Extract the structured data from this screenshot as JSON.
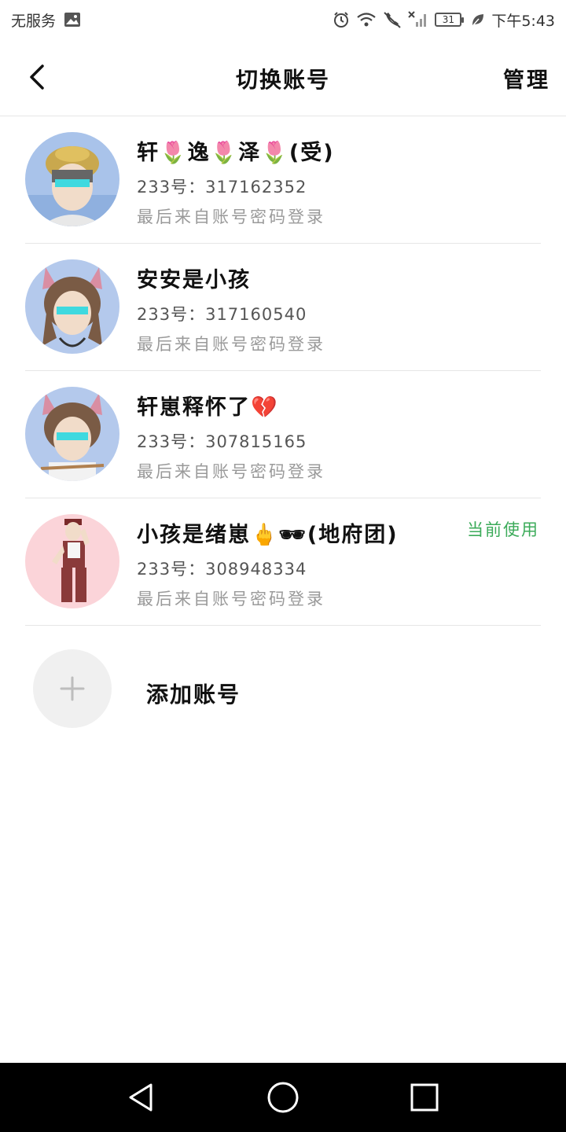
{
  "status_bar": {
    "carrier": "无服务",
    "time": "下午5:43",
    "battery": "31",
    "icons": [
      "image-icon",
      "alarm-icon",
      "wifi-icon",
      "no-call-icon",
      "no-signal-icon",
      "battery-icon",
      "leaf-icon"
    ]
  },
  "header": {
    "title": "切换账号",
    "manage_label": "管理",
    "back_icon": "back-arrow-icon"
  },
  "accounts": [
    {
      "name": "轩🌷逸🌷泽🌷(受)",
      "id_text": "233号：317162352",
      "login_text": "最后来自账号密码登录",
      "current": ""
    },
    {
      "name": "安安是小孩",
      "id_text": "233号：317160540",
      "login_text": "最后来自账号密码登录",
      "current": ""
    },
    {
      "name": "轩崽释怀了💔",
      "id_text": "233号：307815165",
      "login_text": "最后来自账号密码登录",
      "current": ""
    },
    {
      "name": "小孩是绪崽🖕🕶(地府团)",
      "id_text": "233号：308948334",
      "login_text": "最后来自账号密码登录",
      "current": "当前使用"
    }
  ],
  "add_account": {
    "label": "添加账号",
    "icon": "plus-icon"
  },
  "colors": {
    "current_badge": "#3cab5a",
    "divider": "#e6e6e6",
    "secondary_text": "#9a9a9a",
    "navbar": "#000000"
  }
}
